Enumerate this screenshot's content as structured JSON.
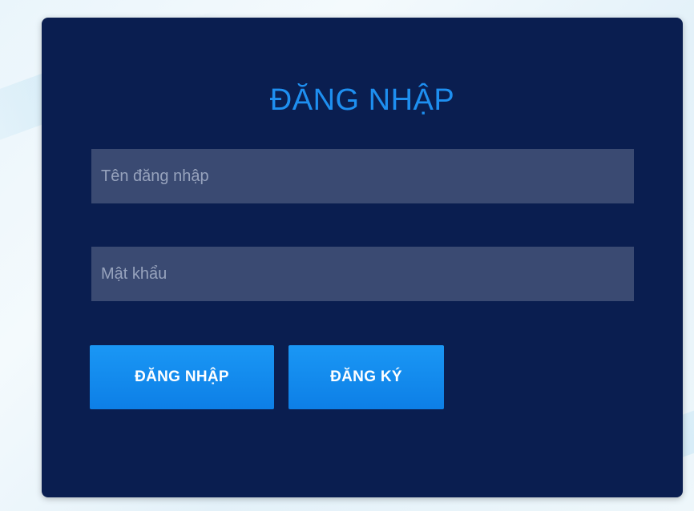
{
  "login": {
    "title": "ĐĂNG NHẬP",
    "username": {
      "value": "",
      "placeholder": "Tên đăng nhập"
    },
    "password": {
      "value": "",
      "placeholder": "Mật khẩu"
    },
    "login_button_label": "ĐĂNG NHẬP",
    "register_button_label": "ĐĂNG KÝ"
  },
  "colors": {
    "card_background": "#0a1e50",
    "title": "#1e8ff0",
    "input_background": "#3a4a72",
    "button": "#1a97f5"
  }
}
